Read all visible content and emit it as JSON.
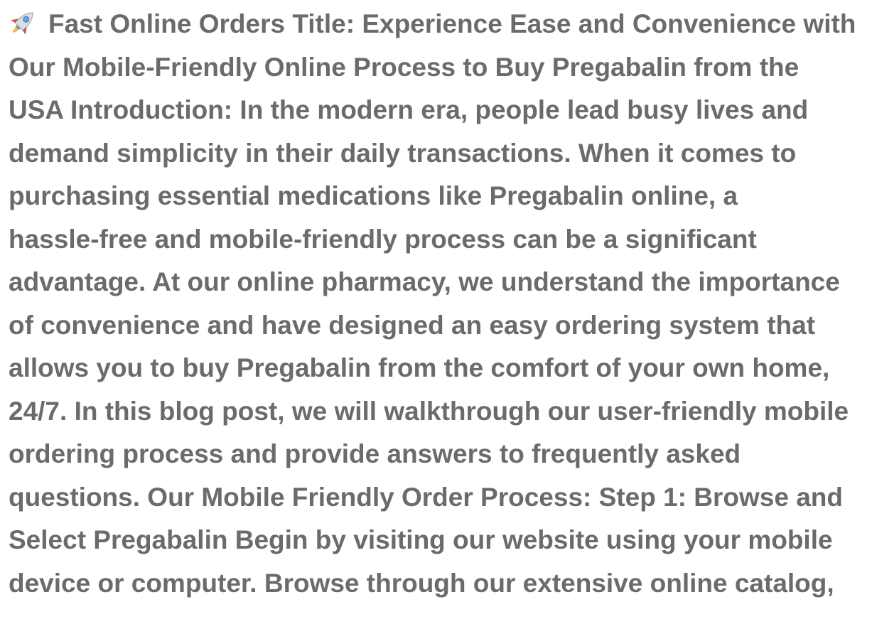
{
  "article": {
    "icon": "rocket-icon",
    "lines": [
      "Fast Online Orders Title: Experience Ease and Convenience with",
      "Our Mobile-Friendly Online Process to Buy Pregabalin from the",
      "USA Introduction: In the modern era, people lead busy lives and",
      "demand simplicity in their daily transactions. When it comes to",
      "purchasing essential medications like Pregabalin online, a",
      "hassle-free and mobile-friendly process can be a significant",
      "advantage. At our online pharmacy, we understand the importance",
      "of convenience and have designed an easy ordering system that",
      "allows you to buy Pregabalin from the comfort of your own home,",
      "24/7. In this blog post, we will walkthrough our user-friendly mobile",
      "ordering process and provide answers to frequently asked",
      "questions. Our Mobile Friendly Order Process: Step 1: Browse and",
      "Select Pregabalin Begin by visiting our website using your mobile",
      "device or computer. Browse through our extensive online catalog,"
    ]
  },
  "colors": {
    "text": "#6b6b6b",
    "background": "#ffffff"
  }
}
